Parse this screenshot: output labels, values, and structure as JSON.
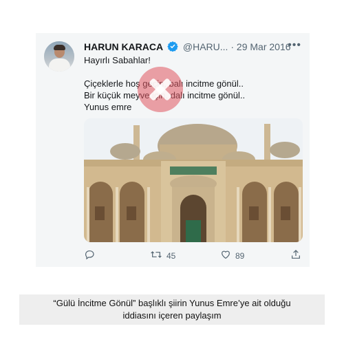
{
  "tweet": {
    "author_name": "HARUN KARACA",
    "author_handle": "@HARU...",
    "separator": "·",
    "date": "29 Mar 2016",
    "more_icon": "more-icon",
    "lines": [
      "Hayırlı Sabahlar!",
      "Çiçeklerle hoş geçin, balı incitme gönül..",
      "Bir küçük meyve için, dalı incitme gönül..",
      "Yunus emre"
    ],
    "actions": {
      "reply_icon": "reply-icon",
      "retweet_icon": "retweet-icon",
      "retweet_count": "45",
      "like_icon": "heart-icon",
      "like_count": "89",
      "share_icon": "share-icon"
    }
  },
  "overlay": {
    "icon": "false-x-icon",
    "color": "#e05660"
  },
  "caption": {
    "line1": "“Gülü İncitme Gönül” başlıklı şiirin Yunus Emre’ye ait olduğu",
    "line2": "iddiasını içeren paylaşım"
  },
  "colors": {
    "accent": "#1d9bf0",
    "muted": "#536471",
    "card_bg": "#f4f6f7",
    "caption_bg": "#eeeeee"
  }
}
